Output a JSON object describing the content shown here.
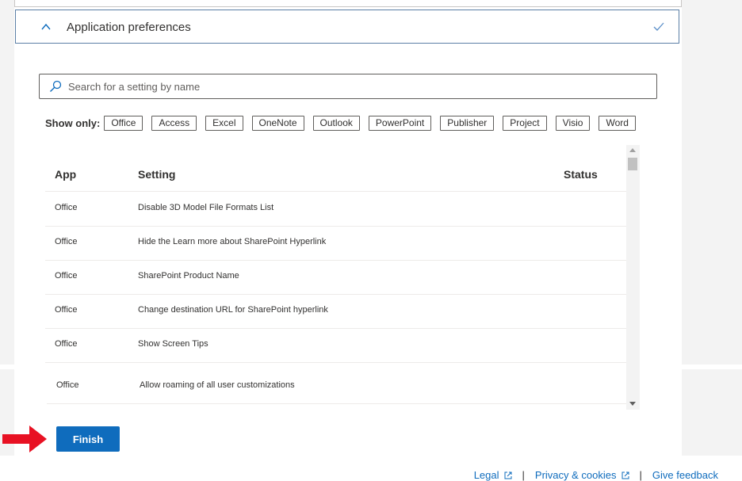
{
  "section": {
    "title": "Application preferences"
  },
  "search": {
    "placeholder": "Search for a setting by name"
  },
  "filters": {
    "label": "Show only:",
    "chips": [
      "Office",
      "Access",
      "Excel",
      "OneNote",
      "Outlook",
      "PowerPoint",
      "Publisher",
      "Project",
      "Visio",
      "Word"
    ]
  },
  "table": {
    "headers": {
      "app": "App",
      "setting": "Setting",
      "status": "Status"
    },
    "rows": [
      {
        "app": "Office",
        "setting": "Disable 3D Model File Formats List"
      },
      {
        "app": "Office",
        "setting": "Hide the Learn more about SharePoint Hyperlink"
      },
      {
        "app": "Office",
        "setting": "SharePoint Product Name"
      },
      {
        "app": "Office",
        "setting": "Change destination URL for SharePoint hyperlink"
      },
      {
        "app": "Office",
        "setting": "Show Screen Tips"
      },
      {
        "app": "Office",
        "setting": "Allow roaming of all user customizations"
      }
    ]
  },
  "actions": {
    "finish_label": "Finish"
  },
  "footer": {
    "legal": "Legal",
    "privacy": "Privacy & cookies",
    "feedback": "Give feedback",
    "separator": "|"
  },
  "colors": {
    "accent": "#0f6cbd",
    "arrow": "#e81123"
  }
}
